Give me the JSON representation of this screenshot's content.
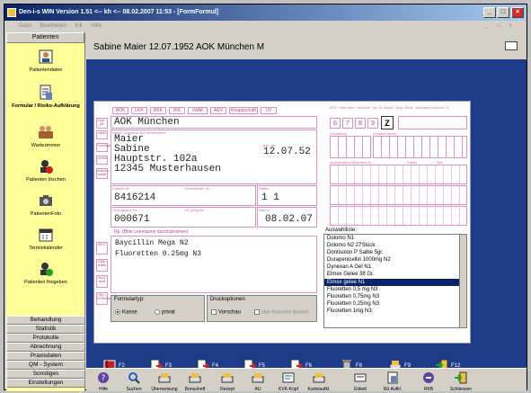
{
  "window": {
    "title": "Den-i-s WIN Version 1.51 <-- kh <-- 08.02.2007  11:53 - [FormFormul]"
  },
  "menu": {
    "items": [
      "Datei",
      "Bearbeiten",
      "Kill",
      "Hilfe"
    ]
  },
  "sidebar": {
    "header": "Patienten",
    "items": [
      {
        "label": "Patientendaten",
        "icon": "patient-card-icon"
      },
      {
        "label": "Formular / Risiko-Aufklärung",
        "icon": "form-document-icon"
      },
      {
        "label": "Wartezimmer",
        "icon": "waiting-room-icon"
      },
      {
        "label": "Patienten löschen",
        "icon": "delete-patient-icon"
      },
      {
        "label": "PatientenFoto",
        "icon": "camera-icon"
      },
      {
        "label": "Terminkalender",
        "icon": "calendar-icon"
      },
      {
        "label": "Patienten freigeben",
        "icon": "release-patient-icon"
      }
    ],
    "bottom": [
      "Behandlung",
      "Statistik",
      "Protokolle",
      "Abrechnung",
      "Praxisdaten",
      "QM - System",
      "Sonstiges",
      "Einstellungen"
    ]
  },
  "patient_header": "Sabine  Maier  12.07.1952  AOK München  M",
  "form": {
    "kassen_tabs": [
      "AOK",
      "LKK",
      "BKK",
      "IKK",
      "VdAK",
      "AEV",
      "Knappschaft",
      "UV"
    ],
    "kasse_name": "AOK München",
    "name_label": "Name, Vorname des Versicherten",
    "lastname": "Maier",
    "firstname": "Sabine",
    "street": "Hauptstr. 102a",
    "city": "12345 Musterhausen",
    "birthdate": "12.07.52",
    "birthdate_label": "geb. am",
    "kassennr_label": "Kassen-Nr.",
    "kassennr": "8416214",
    "versnr_label": "Versicherten-Nr.",
    "status_label": "Status",
    "status": "1  1",
    "vertragsarzt_label": "Vertragsarzt-Nr.",
    "vk_label": "VK gültig bis",
    "datum_label": "Datum",
    "arztnr": "000671",
    "datum": "08.02.07",
    "rp_label": "Rp. (Bitte Leerräume durchstreichen)",
    "rp_lines": [
      "Baycillin Mega N2",
      "Fluoretten 0.25mg N3"
    ],
    "top_boxes": [
      "6",
      "7",
      "8",
      "9",
      "Z"
    ],
    "zuzahlung_label": "Zuzahlung",
    "gesamt_label": "Gesamt-Brutto",
    "apotheke_label": "Arzneimittel-/Hilfsmittel-Nr.",
    "faktor_label": "Faktor",
    "taxe_label": "Taxe",
    "formulartyp_label": "Formulartyp:",
    "radio_kasse": "Kasse",
    "radio_privat": "privat",
    "druck_label": "Druckoptionen",
    "cb_vorschau": "Vorschau",
    "cb_ruecken": "über Rückseite drucken",
    "side_labels": {
      "geb": "Geb.-pfl.",
      "noctu": "noctu",
      "sonst": "Sonstige",
      "unfall": "Unfall",
      "arbeit": "Arbeits-unfall",
      "bvg": "BVG",
      "hilfs": "Hilfs-mittel",
      "impf": "Impf-stoff",
      "spr": "Spr.-St.Bedarf",
      "beg": "Begr.-Pflicht"
    }
  },
  "auswahlliste": {
    "label": "Auswahlliste:",
    "items": [
      "Dolomo N1",
      "Dolomo N2 27Stück",
      "Dontisolon P Salbe 5gr.",
      "Durapenicellin 1000mg N2",
      "Dynexan A Gel N1",
      "Elmex Gelee 38 Gr.",
      "Elmex gelee N1",
      "Fluoretten 0,5 mg N3",
      "Fluoretten 0,75mg N3",
      "Fluoretten 0,25mg N3",
      "Fluoretten 1mg N3"
    ],
    "selected_index": 6
  },
  "fkeys": [
    {
      "label": "F2",
      "icon": "book-icon"
    },
    {
      "label": "F3",
      "icon": "form-arrow-icon"
    },
    {
      "label": "F4",
      "icon": "form-arrow-icon"
    },
    {
      "label": "F5",
      "icon": "form-arrow-icon"
    },
    {
      "label": "F6",
      "icon": "form-arrow-icon"
    },
    {
      "label": "F8",
      "icon": "trash-icon"
    },
    {
      "label": "F9",
      "icon": "print-icon"
    },
    {
      "label": "F12",
      "icon": "exit-door-icon"
    }
  ],
  "toolbar": [
    {
      "label": "Hilfe",
      "icon": "help-icon"
    },
    {
      "label": "Suchen",
      "icon": "search-icon"
    },
    {
      "label": "Überweisung",
      "icon": "referral-icon"
    },
    {
      "label": "Bonusheft",
      "icon": "bonus-booklet-icon"
    },
    {
      "label": "Rezept",
      "icon": "prescription-icon"
    },
    {
      "label": "AU",
      "icon": "sick-note-icon"
    },
    {
      "label": "KVK-Kopf",
      "icon": "card-header-icon"
    },
    {
      "label": "Karteiaufkl.",
      "icon": "file-card-icon"
    },
    {
      "label": "Etikett",
      "icon": "label-icon"
    },
    {
      "label": "Rö.Aufkl.",
      "icon": "xray-icon"
    },
    {
      "label": "RKB",
      "icon": "rkb-icon"
    },
    {
      "label": "Schliessen",
      "icon": "close-door-icon"
    }
  ],
  "colors": {
    "titlebar": "#0a246a",
    "sidebar": "#ffff99",
    "workspace": "#1e3b8a",
    "form_pink": "#e090c0",
    "selection": "#0a246a"
  }
}
